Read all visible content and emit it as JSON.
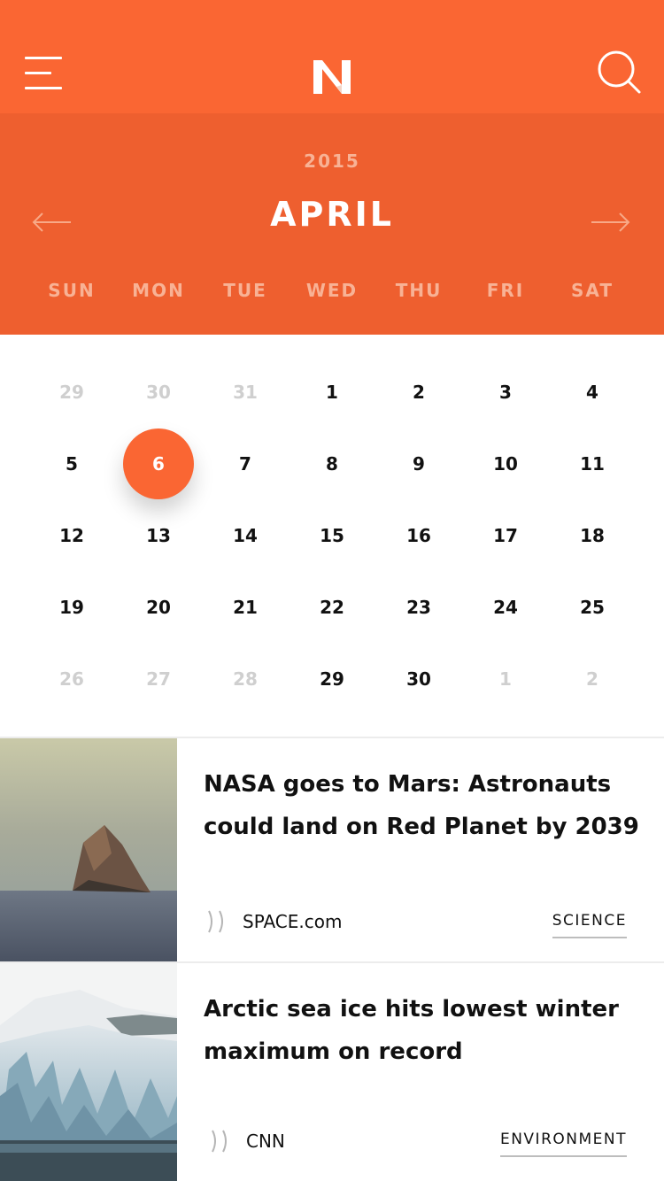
{
  "header": {
    "menu_icon": "hamburger-menu-icon",
    "logo_letter": "N",
    "search_icon": "search-icon",
    "accent_color": "#fa6633",
    "header_color": "#ee5f2f"
  },
  "calendar": {
    "year": "2015",
    "month": "APRIL",
    "prev_icon": "arrow-left-icon",
    "next_icon": "arrow-right-icon",
    "weekdays": [
      "SUN",
      "MON",
      "TUE",
      "WED",
      "THU",
      "FRI",
      "SAT"
    ],
    "selected_day": "6",
    "weeks": [
      [
        {
          "d": "29",
          "m": true
        },
        {
          "d": "30",
          "m": true
        },
        {
          "d": "31",
          "m": true
        },
        {
          "d": "1"
        },
        {
          "d": "2"
        },
        {
          "d": "3"
        },
        {
          "d": "4"
        }
      ],
      [
        {
          "d": "5"
        },
        {
          "d": "6",
          "s": true
        },
        {
          "d": "7"
        },
        {
          "d": "8"
        },
        {
          "d": "9"
        },
        {
          "d": "10"
        },
        {
          "d": "11"
        }
      ],
      [
        {
          "d": "12"
        },
        {
          "d": "13"
        },
        {
          "d": "14"
        },
        {
          "d": "15"
        },
        {
          "d": "16"
        },
        {
          "d": "17"
        },
        {
          "d": "18"
        }
      ],
      [
        {
          "d": "19"
        },
        {
          "d": "20"
        },
        {
          "d": "21"
        },
        {
          "d": "22"
        },
        {
          "d": "23"
        },
        {
          "d": "24"
        },
        {
          "d": "25"
        }
      ],
      [
        {
          "d": "26",
          "m": true
        },
        {
          "d": "27",
          "m": true
        },
        {
          "d": "28",
          "m": true
        },
        {
          "d": "29"
        },
        {
          "d": "30"
        },
        {
          "d": "1",
          "m": true
        },
        {
          "d": "2",
          "m": true
        }
      ]
    ]
  },
  "news": [
    {
      "title": "NASA goes to Mars: Astronauts could land on Red Planet by 2039",
      "source": "SPACE.com",
      "tag": "SCIENCE",
      "source_icon": "broadcast-icon",
      "image": "rock-island-sea-photo"
    },
    {
      "title": "Arctic sea ice hits lowest winter maximum on record",
      "source": "CNN",
      "tag": "ENVIRONMENT",
      "source_icon": "broadcast-icon",
      "image": "glacier-photo"
    }
  ]
}
